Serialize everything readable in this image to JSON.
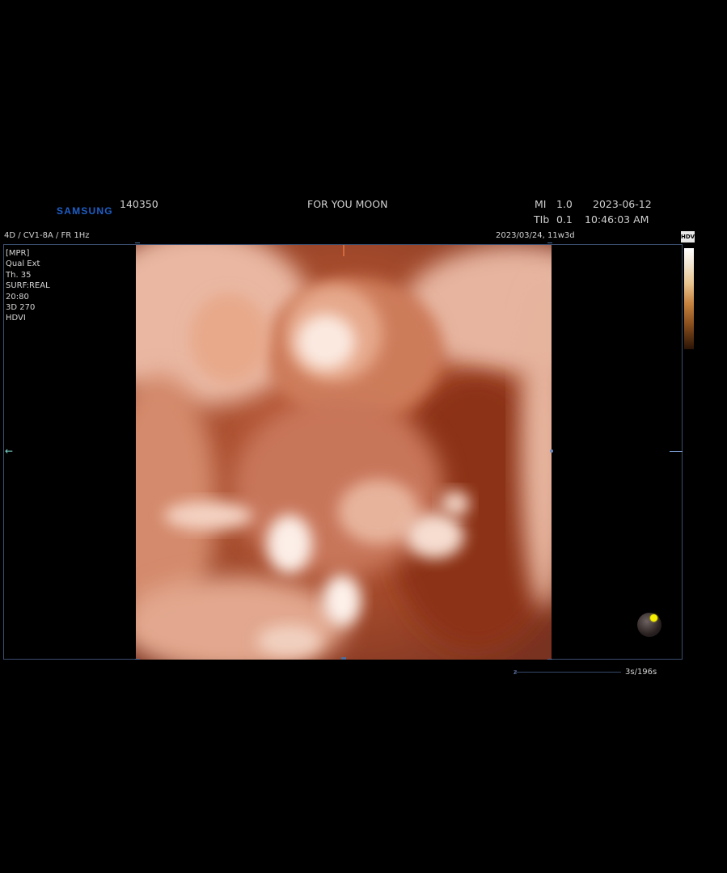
{
  "header": {
    "brand": "SAMSUNG",
    "patient_id": "140350",
    "patient_name": "FOR YOU MOON",
    "mi_label": "MI",
    "mi_value": "1.0",
    "tib_label": "TIb",
    "tib_value": "0.1",
    "date": "2023-06-12",
    "time": "10:46:03 AM"
  },
  "probe_line": "4D / CV1-8A / FR 1Hz",
  "lmp_line": "2023/03/24, 11w3d",
  "left_info": [
    "[MPR]",
    "Qual Ext",
    "Th. 35",
    "SURF:REAL",
    "20:80",
    "3D 270",
    "HDVI"
  ],
  "colorbar": {
    "badge": "HDVI"
  },
  "cine": {
    "counter": "3s/196s",
    "marker": "z"
  },
  "colors": {
    "frame": "#3b4d6e",
    "brand": "#1f5fc8",
    "tissue": "#b0573a"
  }
}
